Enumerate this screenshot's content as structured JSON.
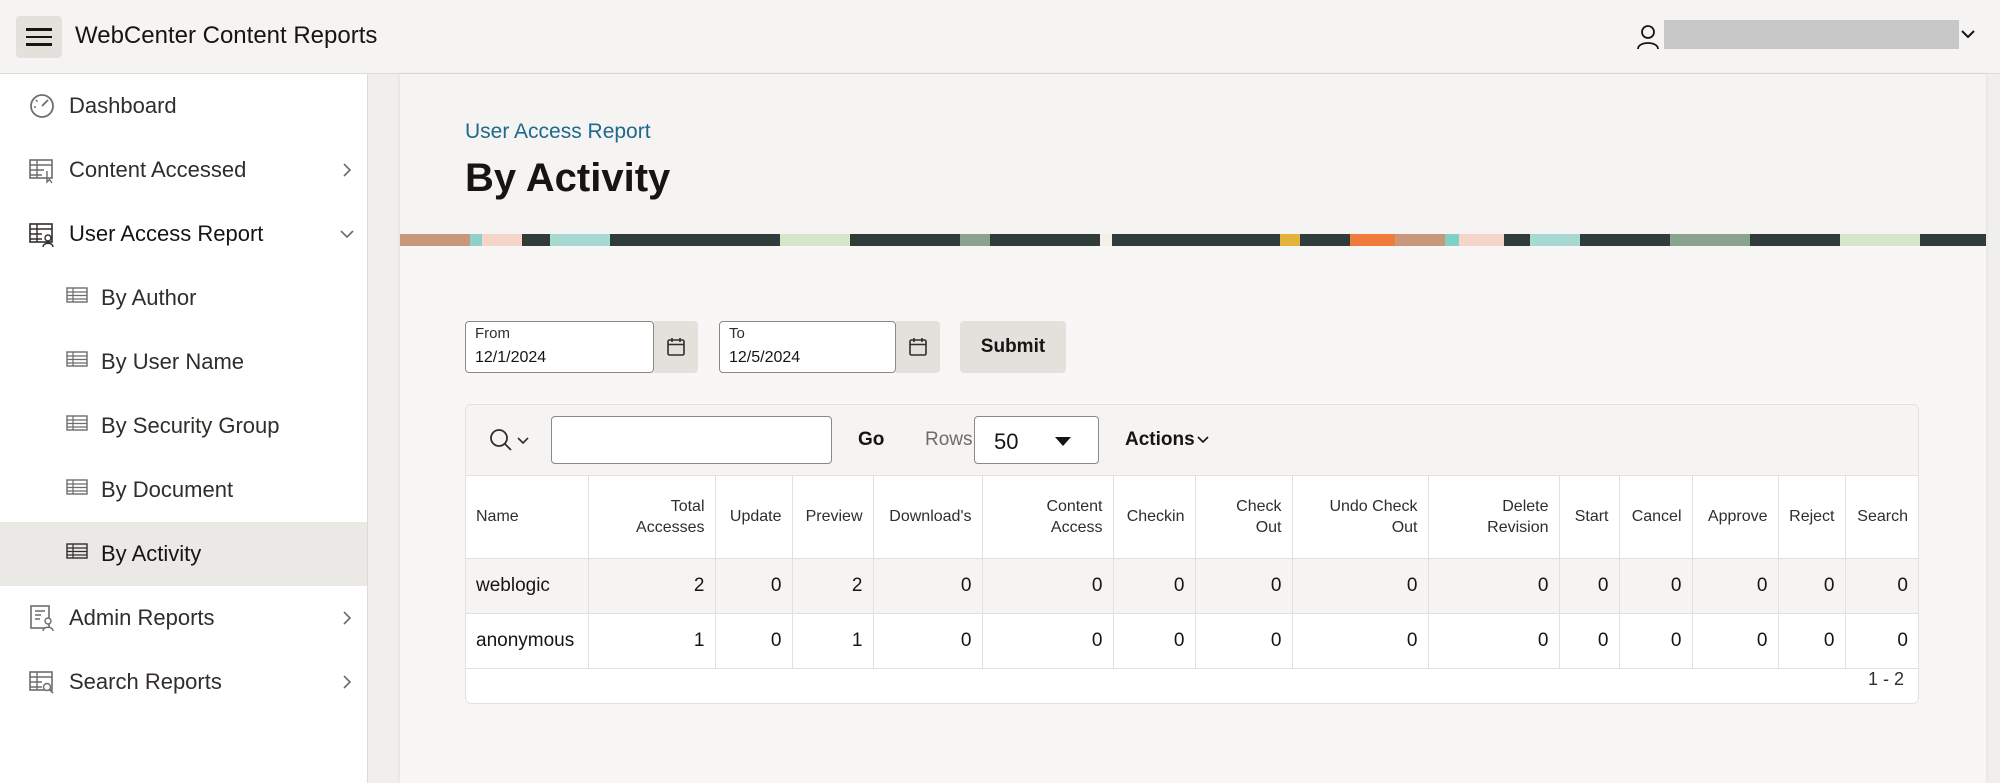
{
  "header": {
    "menu_icon": "hamburger-icon",
    "app_title": "WebCenter Content Reports",
    "user_icon": "user-icon",
    "user_menu_icon": "chevron-down-icon"
  },
  "sidebar": {
    "items": [
      {
        "label": "Dashboard",
        "icon": "dashboard-gauge-icon"
      },
      {
        "label": "Content Accessed",
        "icon": "table-pointer-icon",
        "expand_icon": "chevron-right-icon"
      },
      {
        "label": "User Access Report",
        "icon": "table-user-icon",
        "expand_icon": "chevron-down-icon"
      },
      {
        "label": "By Author",
        "icon": "table-icon"
      },
      {
        "label": "By User Name",
        "icon": "table-icon"
      },
      {
        "label": "By Security Group",
        "icon": "table-icon"
      },
      {
        "label": "By Document",
        "icon": "table-icon"
      },
      {
        "label": "By Activity",
        "icon": "table-icon",
        "selected": true
      },
      {
        "label": "Admin Reports",
        "icon": "report-user-icon",
        "expand_icon": "chevron-right-icon"
      },
      {
        "label": "Search Reports",
        "icon": "table-search-icon",
        "expand_icon": "chevron-right-icon"
      }
    ]
  },
  "main": {
    "breadcrumb": "User Access Report",
    "title": "By Activity",
    "from": {
      "label": "From",
      "value": "12/1/2024"
    },
    "to": {
      "label": "To",
      "value": "12/5/2024"
    },
    "calendar_icon": "calendar-icon",
    "submit_label": "Submit"
  },
  "report": {
    "search_icon": "search-icon",
    "search_value": "",
    "go_label": "Go",
    "rows_label": "Rows",
    "rows_value": "50",
    "actions_label": "Actions",
    "columns": [
      "Name",
      "Total Accesses",
      "Update",
      "Preview",
      "Download's",
      "Content Access",
      "Checkin",
      "Check Out",
      "Undo Check Out",
      "Delete Revision",
      "Start",
      "Cancel",
      "Approve",
      "Reject",
      "Search"
    ],
    "rows": [
      [
        "weblogic",
        "2",
        "0",
        "2",
        "0",
        "0",
        "0",
        "0",
        "0",
        "0",
        "0",
        "0",
        "0",
        "0",
        "0"
      ],
      [
        "anonymous",
        "1",
        "0",
        "1",
        "0",
        "0",
        "0",
        "0",
        "0",
        "0",
        "0",
        "0",
        "0",
        "0",
        "0"
      ]
    ],
    "pagination": "1 - 2"
  },
  "colors": {
    "accent_link": "#1d6a8b",
    "selected_nav": "#ebe9e6",
    "button_bg": "#e4e1dd"
  }
}
